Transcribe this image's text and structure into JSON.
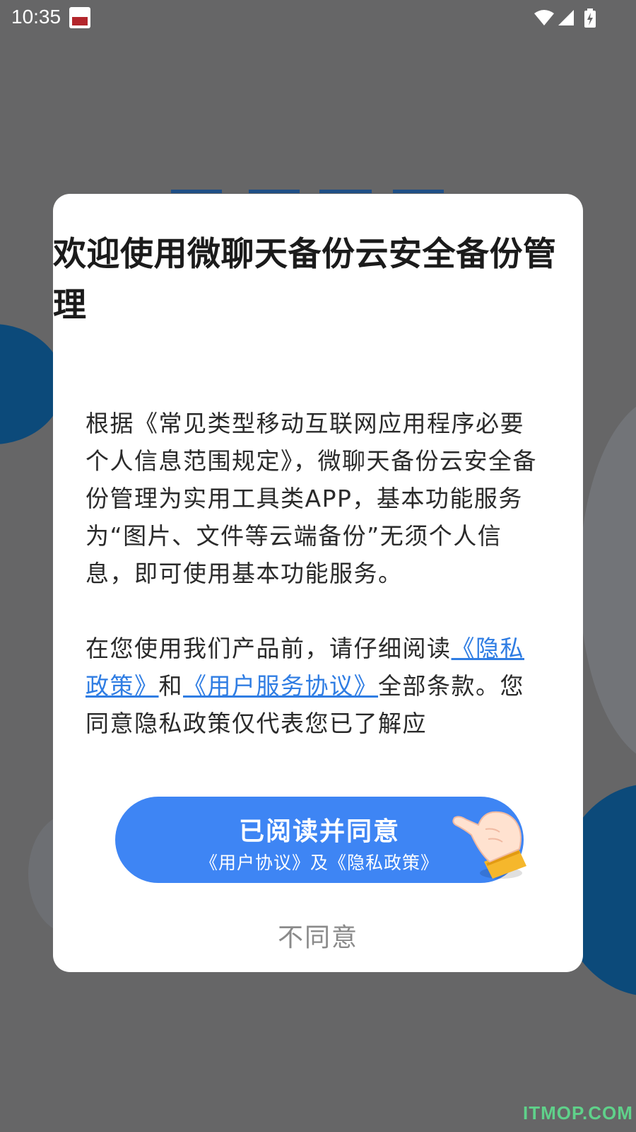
{
  "status_bar": {
    "time": "10:35",
    "icons": [
      "notification-app-icon",
      "wifi-icon",
      "signal-icon",
      "battery-charging-icon"
    ]
  },
  "dialog": {
    "title": "欢迎使用微聊天备份云安全备份管理",
    "paragraph1": "根据《常见类型移动互联网应用程序必要个人信息范围规定》，微聊天备份云安全备份管理为实用工具类APP，基本功能服务为“图片、文件等云端备份”无须个人信息，即可使用基本功能服务。",
    "paragraph2": {
      "prefix": "在您使用我们产品前，请仔细阅读",
      "privacy_link": "《隐私政策》",
      "connector": "和",
      "agreement_link": "《用户服务协议》",
      "suffix": "全部条款。您同意隐私政策仅代表您已了解应"
    },
    "agree_button": {
      "title": "已阅读并同意",
      "subtitle": "《用户协议》及《隐私政策》"
    },
    "disagree_label": "不同意"
  },
  "watermark": "ITMOP.COM",
  "colors": {
    "overlay": "#666667",
    "dialog_bg": "#ffffff",
    "accent_blue": "#3e85f4",
    "link": "#2f7de3",
    "disagree_text": "#8a8a8a",
    "watermark": "#5fd18a"
  }
}
